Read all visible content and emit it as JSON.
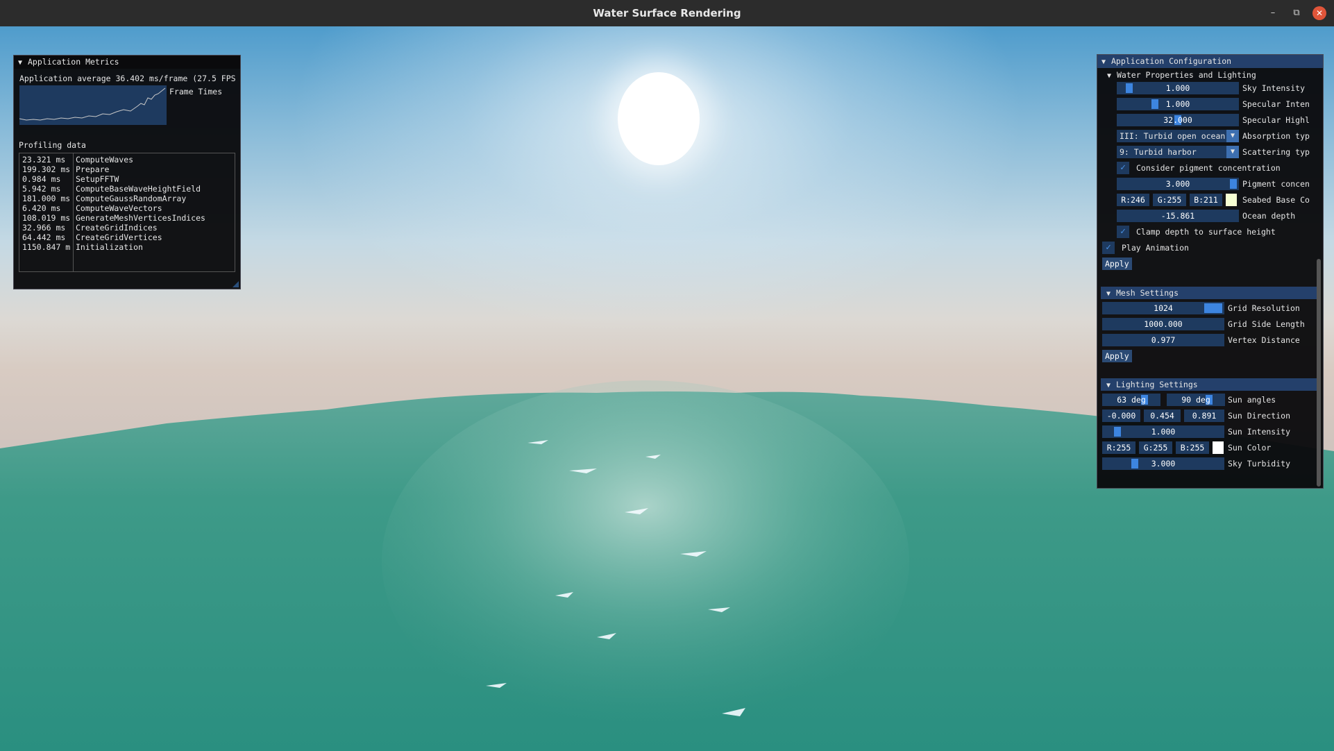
{
  "window": {
    "title": "Water Surface Rendering",
    "minimize_glyph": "–",
    "maximize_glyph": "⧉",
    "close_glyph": "✕"
  },
  "colors": {
    "imgui_header": "#24406b",
    "imgui_frame": "#1e3a5f",
    "imgui_accent": "#3d85e0",
    "ocean": "#2f9a88"
  },
  "metrics": {
    "title": "Application Metrics",
    "average": "Application average 36.402 ms/frame (27.5 FPS",
    "plot_label": "Frame Times",
    "profiling_title": "Profiling data",
    "rows": [
      {
        "ms": "23.321 ms",
        "name": "ComputeWaves"
      },
      {
        "ms": "199.302 ms",
        "name": "Prepare"
      },
      {
        "ms": "0.984 ms",
        "name": "SetupFFTW"
      },
      {
        "ms": "5.942 ms",
        "name": "ComputeBaseWaveHeightField"
      },
      {
        "ms": "181.000 ms",
        "name": "ComputeGaussRandomArray"
      },
      {
        "ms": "6.420 ms",
        "name": "ComputeWaveVectors"
      },
      {
        "ms": "108.019 ms",
        "name": "GenerateMeshVerticesIndices"
      },
      {
        "ms": "32.966 ms",
        "name": "CreateGridIndices"
      },
      {
        "ms": "64.442 ms",
        "name": "CreateGridVertices"
      },
      {
        "ms": "1150.847 m",
        "name": "Initialization"
      }
    ]
  },
  "config": {
    "title": "Application Configuration",
    "water": {
      "title": "Water Properties and Lighting",
      "sky_intensity": {
        "value": "1.000",
        "label": "Sky Intensity",
        "level": 0.08
      },
      "specular_intensity": {
        "value": "1.000",
        "label": "Specular Inten",
        "level": 0.3
      },
      "specular_highlights": {
        "value": "32.000",
        "label": "Specular Highl",
        "level": 0.5
      },
      "absorption": {
        "value": "III: Turbid open ocean",
        "label": "Absorption typ"
      },
      "scattering": {
        "value": "9: Turbid harbor",
        "label": "Scattering typ"
      },
      "pigment_check": {
        "checked": true,
        "label": "Consider pigment concentration"
      },
      "pigment": {
        "value": "3.000",
        "label": "Pigment concen",
        "level": 0.98
      },
      "seabed": {
        "r": "R:246",
        "g": "G:255",
        "b": "B:211",
        "swatch": "#f6ffd3",
        "label": "Seabed Base Co"
      },
      "ocean_depth": {
        "value": "-15.861",
        "label": "Ocean depth"
      },
      "clamp_check": {
        "checked": true,
        "label": "Clamp depth to surface height"
      },
      "play_check": {
        "checked": true,
        "label": "Play Animation"
      },
      "apply": "Apply"
    },
    "mesh": {
      "title": "Mesh Settings",
      "grid_resolution": {
        "value": "1024",
        "label": "Grid Resolution",
        "level": 0.98
      },
      "grid_side_length": {
        "value": "1000.000",
        "label": "Grid Side Length"
      },
      "vertex_distance": {
        "value": "0.977",
        "label": "Vertex Distance"
      },
      "apply": "Apply"
    },
    "lighting": {
      "title": "Lighting Settings",
      "sun_angle_1": {
        "value": "63 deg",
        "level": 0.75
      },
      "sun_angle_2": {
        "value": "90 deg",
        "level": 0.75
      },
      "sun_angles_label": "Sun angles",
      "sun_direction": {
        "x": "-0.000",
        "y": "0.454",
        "z": "0.891",
        "label": "Sun Direction"
      },
      "sun_intensity": {
        "value": "1.000",
        "label": "Sun Intensity",
        "level": 0.1
      },
      "sun_color": {
        "r": "R:255",
        "g": "G:255",
        "b": "B:255",
        "swatch": "#ffffff",
        "label": "Sun Color"
      },
      "sky_turbidity": {
        "value": "3.000",
        "label": "Sky Turbidity",
        "level": 0.25
      }
    }
  }
}
